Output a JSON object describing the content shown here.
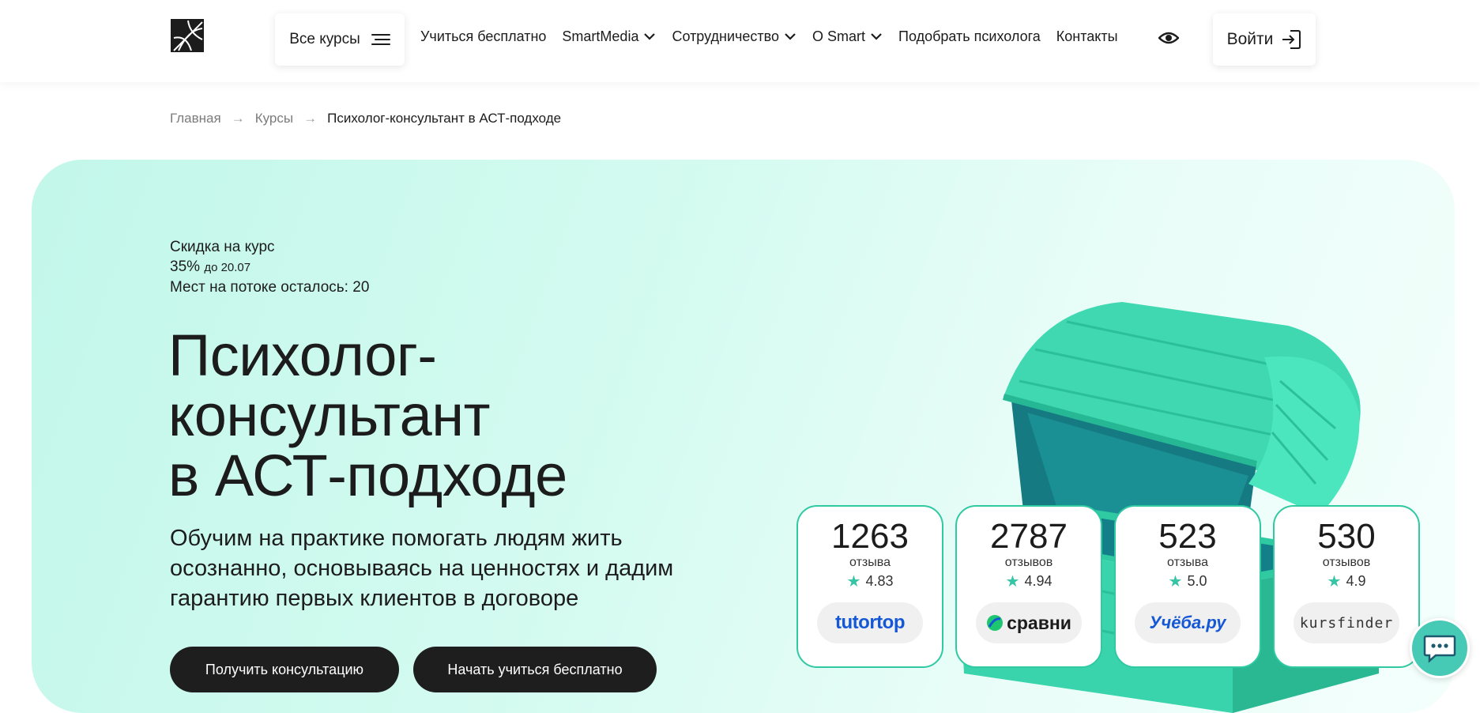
{
  "header": {
    "all_courses_label": "Все курсы",
    "nav": [
      {
        "label": "Учиться бесплатно",
        "dropdown": false
      },
      {
        "label": "SmartMedia",
        "dropdown": true
      },
      {
        "label": "Сотрудничество",
        "dropdown": true
      },
      {
        "label": "O Smart",
        "dropdown": true
      },
      {
        "label": "Подобрать психолога",
        "dropdown": false
      },
      {
        "label": "Контакты",
        "dropdown": false
      }
    ],
    "login_label": "Войти"
  },
  "breadcrumb": {
    "home": "Главная",
    "courses": "Курсы",
    "current": "Психолог-консультант в АСТ-подходе",
    "separator": "→"
  },
  "promo": {
    "discount_label": "Скидка на курс",
    "discount_value": "35%",
    "discount_until": "до 20.07",
    "seats_label": "Мест на потоке осталось:",
    "seats_value": "20"
  },
  "hero": {
    "title_line1": "Психолог-",
    "title_line2": "консультант",
    "title_line3": "в АСТ-подходе",
    "subtitle": "Обучим на практике помогать людям жить осознанно, основываясь на ценностях и дадим гарантию первых клиентов в договоре",
    "btn_consult": "Получить консультацию",
    "btn_free": "Начать учиться бесплатно"
  },
  "reviews": [
    {
      "count": "1263",
      "word": "отзыва",
      "rating": "4.83",
      "platform": "tutortop"
    },
    {
      "count": "2787",
      "word": "отзывов",
      "rating": "4.94",
      "platform": "сравни"
    },
    {
      "count": "523",
      "word": "отзыва",
      "rating": "5.0",
      "platform": "Учёба.ру"
    },
    {
      "count": "530",
      "word": "отзывов",
      "rating": "4.9",
      "platform": "kursfinder"
    }
  ],
  "icons": {
    "logo": "smart-logo-icon",
    "menu": "menu-lines-icon",
    "chevron": "chevron-down-icon",
    "eye": "eye-icon",
    "login": "login-arrow-icon",
    "star": "star-icon",
    "chat": "chat-icon"
  },
  "colors": {
    "accent": "#2fc9a2",
    "hero_bg": "#c2f7ea",
    "button_bg": "#1e1e1e",
    "tutortop_blue": "#1558d6",
    "chat_bg": "#46c9b5"
  }
}
